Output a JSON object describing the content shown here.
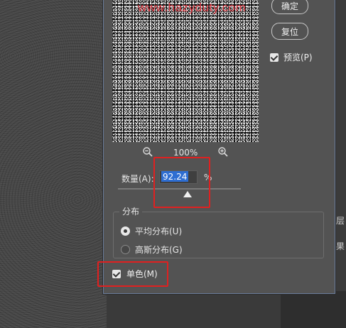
{
  "dialog": {
    "watermark": "www.hazyduty.com",
    "zoom": {
      "level": "100%"
    },
    "buttons": {
      "ok": "确定",
      "reset": "复位"
    },
    "preview_checkbox": {
      "label": "预览(P)",
      "checked": true
    },
    "amount": {
      "label": "数量(A):",
      "value": "92.24",
      "unit": "%",
      "slider_fraction": 0.56
    },
    "distribution": {
      "title": "分布",
      "options": [
        {
          "label": "平均分布(U)",
          "selected": true
        },
        {
          "label": "高斯分布(G)",
          "selected": false
        }
      ]
    },
    "monochrome_checkbox": {
      "label": "单色(M)",
      "checked": true
    }
  },
  "side_panel": {
    "chars": [
      "层",
      "果"
    ]
  },
  "colors": {
    "highlight": "#e02020",
    "selection": "#2e6ed2"
  }
}
